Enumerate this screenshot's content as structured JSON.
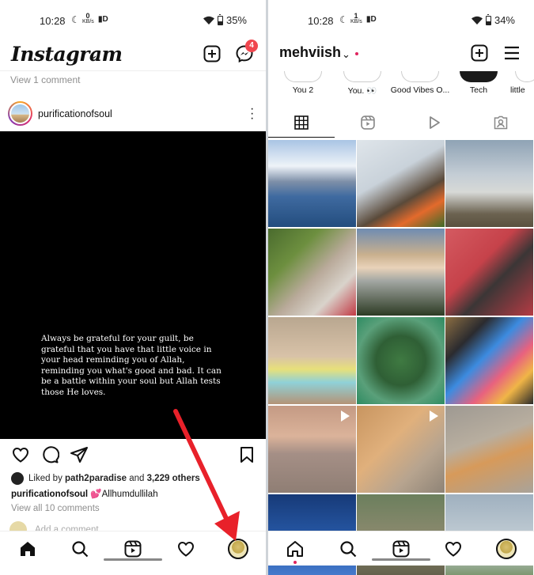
{
  "left_phone": {
    "status": {
      "time": "10:28",
      "kbs_value": "0",
      "kbs_unit": "KB/s",
      "battery": "35%",
      "battery_level": 0.35
    },
    "header": {
      "logo": "Instagram",
      "chevron": "⌄",
      "messenger_badge": "4"
    },
    "view_one_comment": "View 1 comment",
    "post": {
      "username": "purificationofsoul",
      "quote": "Always be grateful for your guilt, be grateful that you have that little voice in your head reminding you of Allah, reminding you what's good and bad. It can be a battle within your soul but Allah tests those He loves.",
      "liked_prefix": "Liked by ",
      "liked_user": "path2paradise",
      "liked_mid": " and ",
      "liked_count": "3,229 others",
      "caption_user": "purificationofsoul",
      "caption_text": "💕Allhumdullilah",
      "view_all": "View all 10 comments",
      "add_comment": "Add a comment..."
    }
  },
  "right_phone": {
    "status": {
      "time": "10:28",
      "kbs_value": "1",
      "kbs_unit": "KB/s",
      "battery": "34%",
      "battery_level": 0.34
    },
    "profile": {
      "username": "mehviish",
      "chevron": "⌄"
    },
    "highlights": [
      {
        "label": "You 2"
      },
      {
        "label": "You. 👀"
      },
      {
        "label": "Good Vibes O..."
      },
      {
        "label": "Tech"
      },
      {
        "label": "little"
      }
    ],
    "grid": [
      {
        "bg": "linear-gradient(180deg,#a9c4e4 0%,#eef3f8 30%,#7d8fa8 48%,#3f6aa0 65%,#234d7e 100%)",
        "reel": false
      },
      {
        "bg": "linear-gradient(150deg,#dfe5ea 0%,#c9d2da 40%,#5a4a3a 65%,#e36a2c 80%,#3d6b2a 100%)",
        "reel": false
      },
      {
        "bg": "linear-gradient(180deg,#8fa3b5 0%,#c4cdd5 40%,#d7d9d6 60%,#6b6250 85%,#5a513f 100%)",
        "reel": false
      },
      {
        "bg": "linear-gradient(135deg,#4a6b2e 0%,#6d8f3f 30%,#b9aa9a 55%,#d9d3cb 75%,#c23a45 100%)",
        "reel": false
      },
      {
        "bg": "linear-gradient(180deg,#6f8cb2 0%,#c9b08e 30%,#e9d2b9 45%,#a3a7a3 60%,#2d3b24 100%)",
        "reel": false
      },
      {
        "bg": "linear-gradient(135deg,#d45a61 0%,#c6424a 40%,#3b3636 60%,#b53b44 100%)",
        "reel": false
      },
      {
        "bg": "linear-gradient(180deg,#b9a790 0%,#d8c2a8 45%,#e7e07a 60%,#8fd1d8 75%,#b49376 100%)",
        "reel": false
      },
      {
        "bg": "radial-gradient(circle at 50% 50%,#3f7a42 0%,#2f5f35 40%,#5aa07a 70%,#2e8b62 100%)",
        "reel": false
      },
      {
        "bg": "linear-gradient(135deg,#8c6e42 0%,#2b2b2f 25%,#3c8be0 45%,#e8617f 65%,#f0b547 80%,#2a2a2a 100%)",
        "reel": false
      },
      {
        "bg": "linear-gradient(180deg,#c49a84 0%,#dbb39a 35%,#a58f86 55%,#8f7e74 100%)",
        "reel": true
      },
      {
        "bg": "linear-gradient(135deg,#c89560 0%,#e0b07c 40%,#b7a48f 70%,#8e8376 100%)",
        "reel": true
      },
      {
        "bg": "linear-gradient(160deg,#9e9992 0%,#b8ae9f 40%,#d79a5a 60%,#a9a39a 100%)",
        "reel": false
      },
      {
        "bg": "linear-gradient(180deg,#173a78 0%,#2a5fb0 60%,#4b7fd1 100%)",
        "reel": false
      },
      {
        "bg": "linear-gradient(180deg,#6b7f5d 0%,#8d8a6f 50%,#5d5a46 100%)",
        "reel": false
      },
      {
        "bg": "linear-gradient(180deg,#9fb0bf 0%,#c8d2d8 60%,#6d8a59 100%)",
        "reel": false
      }
    ]
  },
  "colors": {
    "badge": "#f0474f",
    "arrow": "#e8212a",
    "text": "#111111",
    "muted": "#8e8e8e"
  }
}
